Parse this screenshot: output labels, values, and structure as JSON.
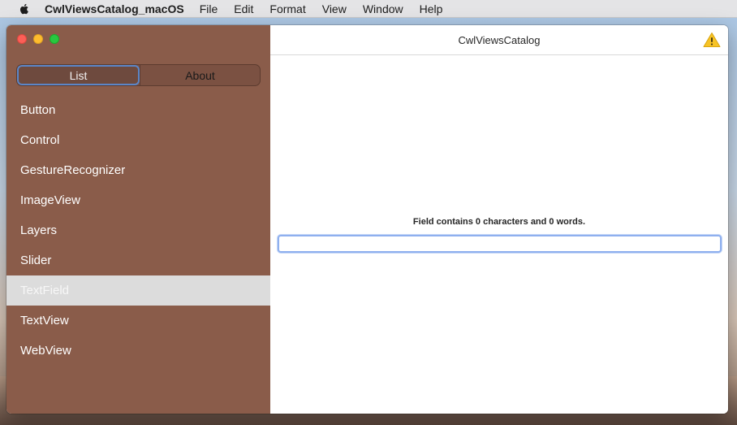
{
  "menubar": {
    "app_name": "CwlViewsCatalog_macOS",
    "items": [
      "File",
      "Edit",
      "Format",
      "View",
      "Window",
      "Help"
    ]
  },
  "window": {
    "title": "CwlViewsCatalog"
  },
  "sidebar": {
    "segments": [
      "List",
      "About"
    ],
    "selected_segment": "List",
    "items": [
      "Button",
      "Control",
      "GestureRecognizer",
      "ImageView",
      "Layers",
      "Slider",
      "TextField",
      "TextView",
      "WebView"
    ],
    "selected_item": "TextField"
  },
  "content": {
    "field_label": "Field contains 0 characters and 0 words.",
    "field_value": ""
  },
  "colors": {
    "sidebar": "#8a5c4a",
    "selection": "#dcdcdc",
    "focus_ring": "#8fb0ef"
  }
}
